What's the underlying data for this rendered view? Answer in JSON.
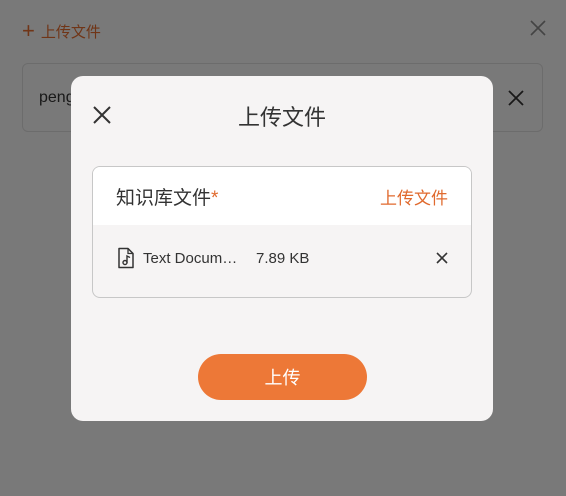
{
  "background": {
    "add_file_label": "上传文件",
    "field_value": "peng"
  },
  "modal": {
    "title": "上传文件",
    "card": {
      "label": "知识库文件",
      "required_mark": "*",
      "upload_link": "上传文件"
    },
    "file": {
      "name": "Text Docum…",
      "size": "7.89 KB",
      "icon": "music-file-icon"
    },
    "submit_label": "上传"
  },
  "colors": {
    "accent": "#ED7837",
    "link": "#E06A2E",
    "overlay": "rgba(0,0,0,0.5)",
    "modal_bg": "#F6F4F4"
  }
}
